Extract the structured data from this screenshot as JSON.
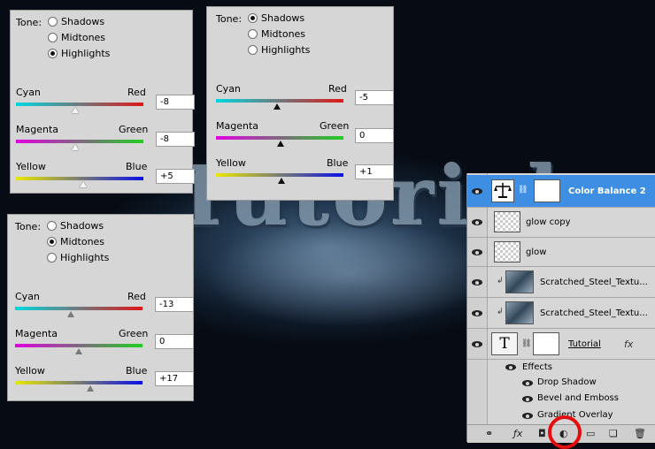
{
  "panels": [
    {
      "tone_label": "Tone:",
      "tones": [
        "Shadows",
        "Midtones",
        "Highlights"
      ],
      "selected": "Highlights",
      "sliders": [
        {
          "left": "Cyan",
          "right": "Red",
          "value": "-8"
        },
        {
          "left": "Magenta",
          "right": "Green",
          "value": "-8"
        },
        {
          "left": "Yellow",
          "right": "Blue",
          "value": "+5"
        }
      ]
    },
    {
      "tone_label": "Tone:",
      "tones": [
        "Shadows",
        "Midtones",
        "Highlights"
      ],
      "selected": "Shadows",
      "sliders": [
        {
          "left": "Cyan",
          "right": "Red",
          "value": "-5"
        },
        {
          "left": "Magenta",
          "right": "Green",
          "value": "0"
        },
        {
          "left": "Yellow",
          "right": "Blue",
          "value": "+1"
        }
      ]
    },
    {
      "tone_label": "Tone:",
      "tones": [
        "Shadows",
        "Midtones",
        "Highlights"
      ],
      "selected": "Midtones",
      "sliders": [
        {
          "left": "Cyan",
          "right": "Red",
          "value": "-13"
        },
        {
          "left": "Magenta",
          "right": "Green",
          "value": "0"
        },
        {
          "left": "Yellow",
          "right": "Blue",
          "value": "+17"
        }
      ]
    }
  ],
  "background": {
    "text": "Tutorial"
  },
  "layers": {
    "rows": [
      {
        "name": "Color Balance 2",
        "selected": true
      },
      {
        "name": "glow copy"
      },
      {
        "name": "glow"
      },
      {
        "name": "Scratched_Steel_Textu..."
      },
      {
        "name": "Scratched_Steel_Textu..."
      },
      {
        "name": "Tutorial",
        "fx": "fx"
      }
    ],
    "effects_label": "Effects",
    "effects": [
      "Drop Shadow",
      "Bevel and Emboss",
      "Gradient Overlay"
    ],
    "text_layer_glyph": "T"
  },
  "colors": {
    "selection": "#3e8fe4",
    "highlight_circle": "#e40c0c"
  }
}
